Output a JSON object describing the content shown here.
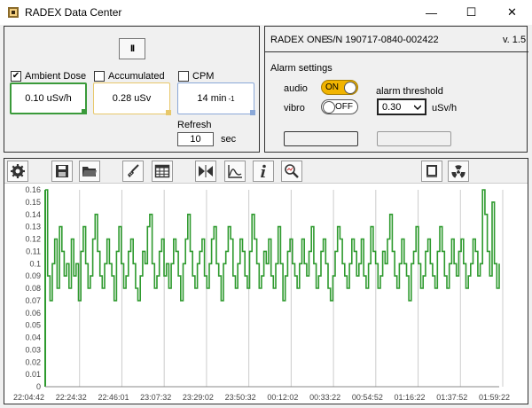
{
  "window": {
    "title": "RADEX Data Center",
    "controls": {
      "minimize": "—",
      "maximize": "☐",
      "close": "✕"
    }
  },
  "controls": {
    "pause_label": "II",
    "ambient": {
      "label": "Ambient Dose",
      "checked": true,
      "value": "0.10 uSv/h",
      "color": "#3a9a3a"
    },
    "accumulated": {
      "label": "Accumulated",
      "checked": false,
      "value": "0.28 uSv",
      "color": "#e8c86a"
    },
    "cpm": {
      "label": "CPM",
      "checked": false,
      "value": "14 min",
      "superscript": "-1",
      "color": "#8aa8d8"
    },
    "refresh": {
      "label": "Refresh",
      "value": "10",
      "unit": "sec"
    }
  },
  "device": {
    "name": "RADEX ONE",
    "serial": "S/N 190717-0840-002422",
    "version": "v. 1.5",
    "alarm_title": "Alarm settings",
    "audio": {
      "label": "audio",
      "state": "ON"
    },
    "vibro": {
      "label": "vibro",
      "state": "OFF"
    },
    "threshold": {
      "label": "alarm threshold",
      "value": "0.30",
      "unit": "uSv/h"
    }
  },
  "toolbar": {
    "icons": [
      "settings-icon",
      "save-icon",
      "open-folder-icon",
      "clear-broom-icon",
      "table-icon",
      "fit-icon",
      "curve-icon",
      "info-icon",
      "search-icon",
      "book-icon",
      "radiation-icon"
    ]
  },
  "chart_data": {
    "type": "line",
    "series_color": "#2e9a2e",
    "ylim": [
      0,
      0.16
    ],
    "yticks": [
      "0.16",
      "0.15",
      "0.14",
      "0.13",
      "0.12",
      "0.11",
      "0.1",
      "0.09",
      "0.08",
      "0.07",
      "0.06",
      "0.05",
      "0.04",
      "0.03",
      "0.02",
      "0.01",
      "0"
    ],
    "xticks": [
      "22:04:42",
      "22:24:32",
      "22:46:01",
      "23:07:32",
      "23:29:02",
      "23:50:32",
      "00:12:02",
      "00:33:22",
      "00:54:52",
      "01:16:22",
      "01:37:52",
      "01:59:22"
    ],
    "grid_vertical": true,
    "values": [
      0.16,
      0.09,
      0.07,
      0.1,
      0.12,
      0.08,
      0.13,
      0.11,
      0.09,
      0.1,
      0.08,
      0.12,
      0.09,
      0.1,
      0.07,
      0.11,
      0.13,
      0.1,
      0.08,
      0.09,
      0.12,
      0.14,
      0.11,
      0.09,
      0.08,
      0.1,
      0.12,
      0.1,
      0.09,
      0.07,
      0.11,
      0.13,
      0.1,
      0.08,
      0.09,
      0.11,
      0.12,
      0.1,
      0.08,
      0.07,
      0.09,
      0.11,
      0.1,
      0.13,
      0.14,
      0.1,
      0.08,
      0.09,
      0.11,
      0.12,
      0.09,
      0.1,
      0.08,
      0.1,
      0.12,
      0.11,
      0.09,
      0.07,
      0.1,
      0.12,
      0.14,
      0.11,
      0.09,
      0.08,
      0.1,
      0.11,
      0.12,
      0.09,
      0.08,
      0.1,
      0.12,
      0.13,
      0.1,
      0.09,
      0.07,
      0.1,
      0.11,
      0.13,
      0.12,
      0.09,
      0.08,
      0.1,
      0.12,
      0.11,
      0.09,
      0.08,
      0.11,
      0.14,
      0.12,
      0.1,
      0.08,
      0.09,
      0.11,
      0.1,
      0.12,
      0.09,
      0.08,
      0.1,
      0.13,
      0.1,
      0.07,
      0.09,
      0.11,
      0.12,
      0.1,
      0.09,
      0.08,
      0.1,
      0.12,
      0.1,
      0.09,
      0.11,
      0.13,
      0.1,
      0.08,
      0.09,
      0.11,
      0.12,
      0.1,
      0.08,
      0.07,
      0.09,
      0.11,
      0.13,
      0.12,
      0.1,
      0.09,
      0.08,
      0.1,
      0.12,
      0.11,
      0.09,
      0.1,
      0.12,
      0.09,
      0.08,
      0.1,
      0.13,
      0.11,
      0.1,
      0.08,
      0.09,
      0.11,
      0.1,
      0.12,
      0.14,
      0.11,
      0.09,
      0.08,
      0.1,
      0.12,
      0.1,
      0.09,
      0.07,
      0.1,
      0.11,
      0.13,
      0.1,
      0.08,
      0.09,
      0.11,
      0.12,
      0.1,
      0.09,
      0.08,
      0.11,
      0.13,
      0.11,
      0.09,
      0.08,
      0.1,
      0.12,
      0.1,
      0.09,
      0.11,
      0.12,
      0.1,
      0.08,
      0.09,
      0.1,
      0.12,
      0.11,
      0.09,
      0.1,
      0.16,
      0.14,
      0.11,
      0.09,
      0.15,
      0.1,
      0.08,
      0.1
    ]
  }
}
